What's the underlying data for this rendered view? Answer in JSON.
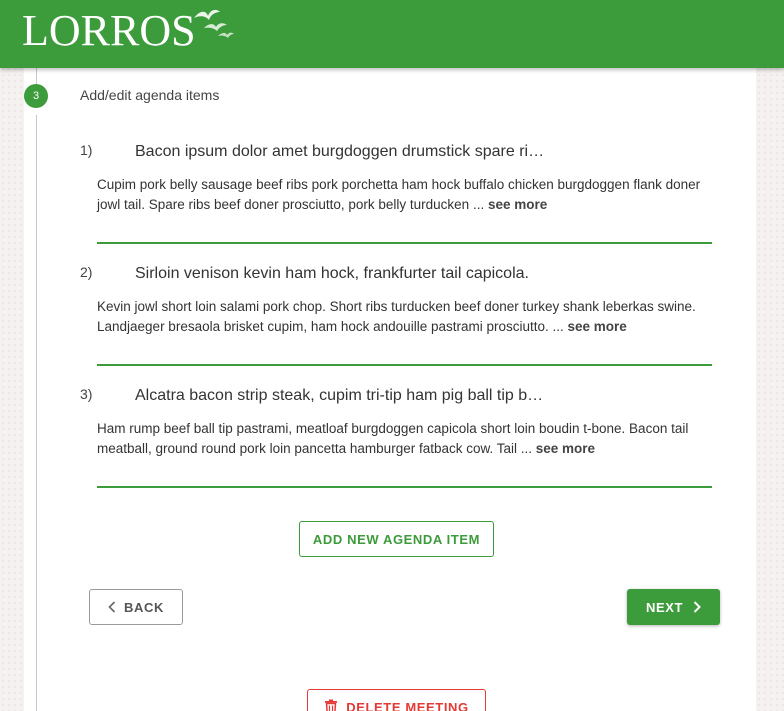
{
  "header": {
    "logo_text": "LORROS",
    "brand_color": "#3c9b3a"
  },
  "step": {
    "number": "3",
    "title": "Add/edit agenda items"
  },
  "agenda_items": [
    {
      "number": "1)",
      "title": "Bacon ipsum dolor amet burgdoggen drumstick spare ri…",
      "description": "Cupim pork belly sausage beef ribs pork porchetta ham hock buffalo chicken burgdoggen flank doner jowl tail. Spare ribs beef doner prosciutto, pork belly turducken ...",
      "see_more": "see more"
    },
    {
      "number": "2)",
      "title": "Sirloin venison kevin ham hock, frankfurter tail capicola.",
      "description": "Kevin jowl short loin salami pork chop. Short ribs turducken beef doner turkey shank leberkas swine. Landjaeger bresaola brisket cupim, ham hock andouille pastrami prosciutto. ...",
      "see_more": "see more"
    },
    {
      "number": "3)",
      "title": "Alcatra bacon strip steak, cupim tri-tip ham pig ball tip b…",
      "description": "Ham rump beef ball tip pastrami, meatloaf burgdoggen capicola short loin boudin t-bone. Bacon tail meatball, ground round pork loin pancetta hamburger fatback cow. Tail ...",
      "see_more": "see more"
    }
  ],
  "buttons": {
    "add_item": "ADD NEW AGENDA ITEM",
    "back": "BACK",
    "next": "NEXT",
    "delete": "DELETE MEETING"
  },
  "icons": {
    "back": "chevron-left-icon",
    "next": "chevron-right-icon",
    "delete": "trash-icon",
    "logo": "birds-icon"
  },
  "colors": {
    "accent": "#3c9b3a",
    "danger": "#e53935"
  }
}
